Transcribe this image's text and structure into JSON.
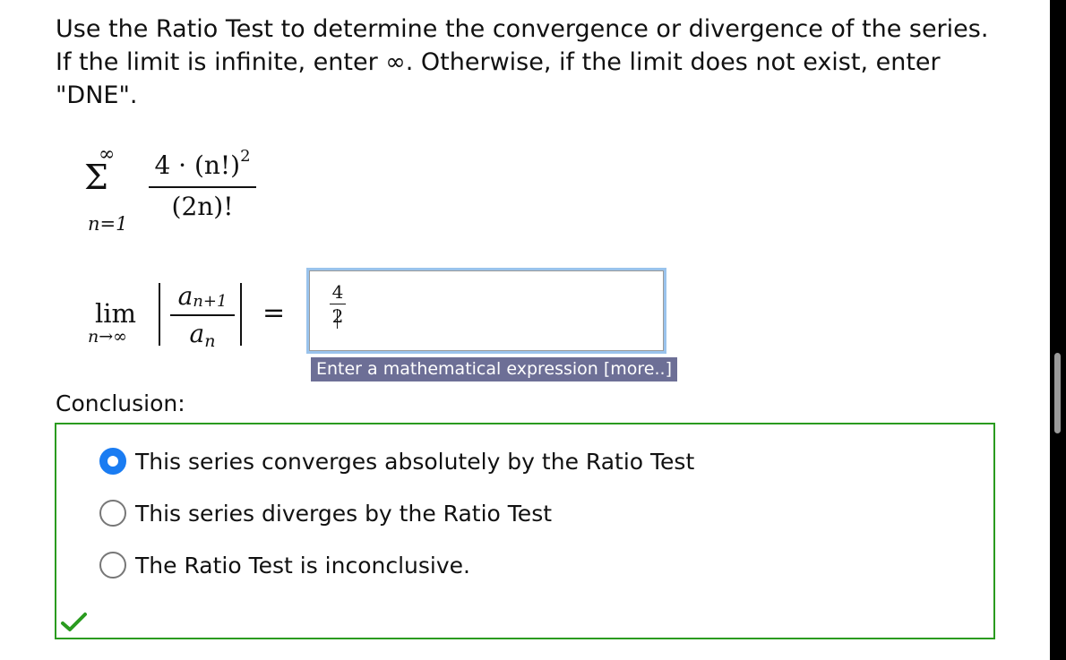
{
  "question": {
    "prompt": "Use the Ratio Test to determine the convergence or divergence of the series. If the limit is infinite, enter ∞. Otherwise, if the limit does not exist, enter \"DNE\"."
  },
  "series": {
    "sum_upper": "∞",
    "sum_symbol": "Σ",
    "sum_lower": "n=1",
    "numerator": "4 · (n!)",
    "numerator_exponent": "2",
    "denominator": "(2n)!"
  },
  "limit": {
    "lim": "lim",
    "lim_sub": "n→∞",
    "ratio_num_base": "a",
    "ratio_num_sub": "n+1",
    "ratio_den_base": "a",
    "ratio_den_sub": "n",
    "equals": "="
  },
  "answer_input": {
    "numerator": "4",
    "denominator": "2"
  },
  "hint": "Enter a mathematical expression [more..]",
  "conclusion": {
    "label": "Conclusion:",
    "options": [
      {
        "label": "This series converges absolutely by the Ratio Test",
        "selected": true
      },
      {
        "label": "This series diverges by the Ratio Test",
        "selected": false
      },
      {
        "label": "The Ratio Test is inconclusive.",
        "selected": false
      }
    ],
    "status": "correct"
  },
  "colors": {
    "correct_border": "#2a9b1f",
    "selected_radio": "#1a7cf2",
    "hint_bg": "#6d6f96",
    "input_focus": "#9ac3ec"
  }
}
